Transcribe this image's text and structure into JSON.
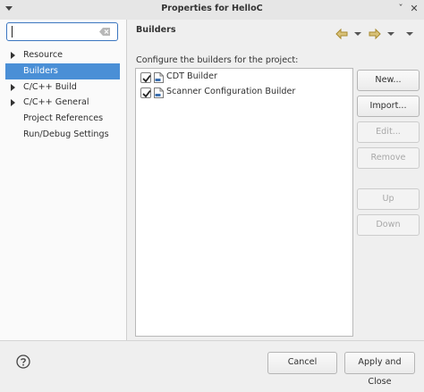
{
  "window": {
    "title": "Properties for HelloC",
    "minimize_glyph": "ˇ",
    "close_glyph": "✕"
  },
  "filter": {
    "value": "",
    "placeholder": ""
  },
  "tree": [
    {
      "label": "Resource",
      "expandable": true,
      "selected": false
    },
    {
      "label": "Builders",
      "expandable": false,
      "selected": true
    },
    {
      "label": "C/C++ Build",
      "expandable": true,
      "selected": false
    },
    {
      "label": "C/C++ General",
      "expandable": true,
      "selected": false
    },
    {
      "label": "Project References",
      "expandable": false,
      "selected": false
    },
    {
      "label": "Run/Debug Settings",
      "expandable": false,
      "selected": false
    }
  ],
  "page": {
    "title": "Builders",
    "description": "Configure the builders for the project:"
  },
  "builders": [
    {
      "label": "CDT Builder",
      "checked": true,
      "icon": "builder-file-icon"
    },
    {
      "label": "Scanner Configuration Builder",
      "checked": true,
      "icon": "builder-file-icon"
    }
  ],
  "buttons": {
    "new": "New...",
    "import": "Import...",
    "edit": "Edit...",
    "remove": "Remove",
    "up": "Up",
    "down": "Down",
    "cancel": "Cancel",
    "apply_close": "Apply and Close"
  },
  "icons": {
    "help": "help-icon",
    "back": "back-arrow-icon",
    "forward": "forward-arrow-icon"
  },
  "colors": {
    "selection": "#4a8fd6",
    "accent": "#3c76c0",
    "nav_arrow": "#c8a43c"
  }
}
